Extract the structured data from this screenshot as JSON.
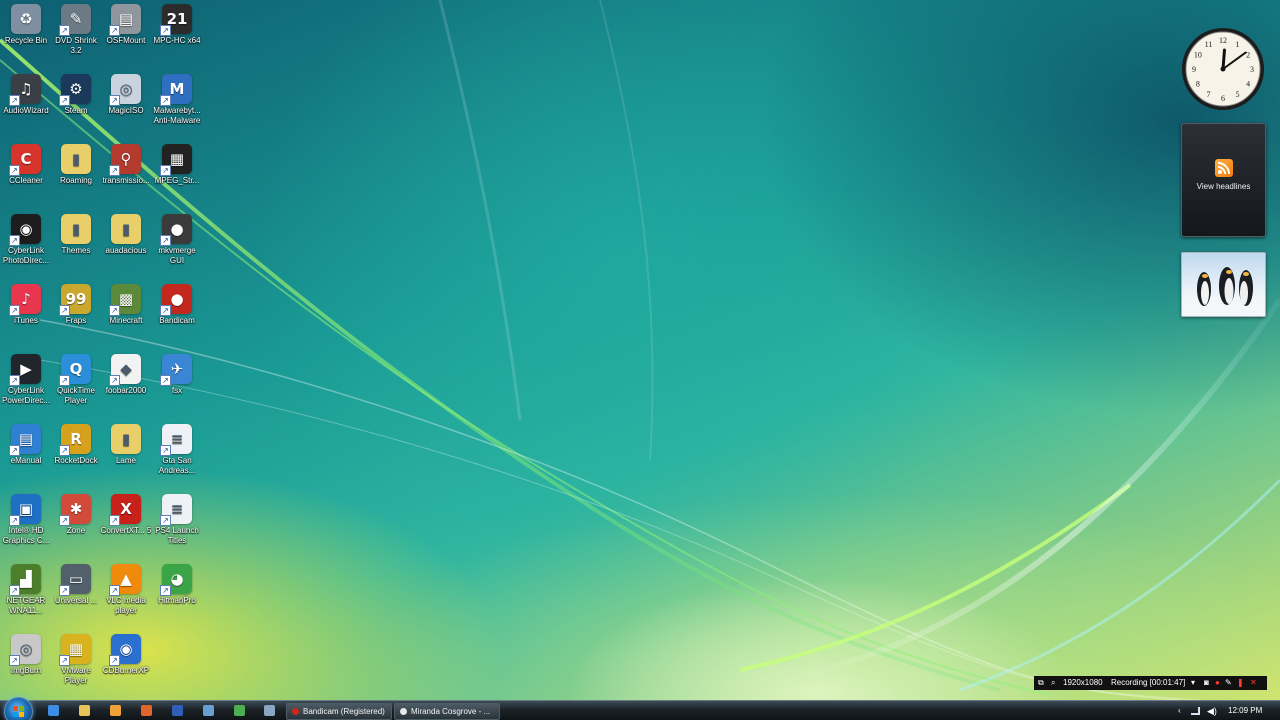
{
  "desktop_icons": [
    {
      "label": "Recycle Bin",
      "icon": "recycle-bin-icon",
      "color": "#7d8fa0",
      "glyph": "♻",
      "shortcut": false
    },
    {
      "label": "DVD Shrink 3.2",
      "icon": "dvd-shrink-icon",
      "color": "#6c7a86",
      "glyph": "✎",
      "shortcut": true
    },
    {
      "label": "OSFMount",
      "icon": "osfmount-icon",
      "color": "#8f969d",
      "glyph": "▤",
      "shortcut": true
    },
    {
      "label": "MPC-HC x64",
      "icon": "mpc-hc-icon",
      "color": "#2c2c2c",
      "glyph": "21",
      "shortcut": true
    },
    {
      "label": "AudioWizard",
      "icon": "audiowizard-icon",
      "color": "#3a3f46",
      "glyph": "♫",
      "shortcut": true
    },
    {
      "label": "Steam",
      "icon": "steam-icon",
      "color": "#1b3a5b",
      "glyph": "⚙",
      "shortcut": true
    },
    {
      "label": "MagicISO",
      "icon": "magiciso-icon",
      "color": "#c9d3df",
      "glyph": "◎",
      "shortcut": true
    },
    {
      "label": "Malwarebyt... Anti-Malware",
      "icon": "malwarebytes-icon",
      "color": "#2f6fc1",
      "glyph": "M",
      "shortcut": true
    },
    {
      "label": "CCleaner",
      "icon": "ccleaner-icon",
      "color": "#d8342c",
      "glyph": "C",
      "shortcut": true
    },
    {
      "label": "Roaming",
      "icon": "folder-icon",
      "color": "#e8cf6a",
      "glyph": "▮",
      "shortcut": false
    },
    {
      "label": "transmissio...",
      "icon": "transmission-icon",
      "color": "#b23b2e",
      "glyph": "⚲",
      "shortcut": true
    },
    {
      "label": "MPEG_Str...",
      "icon": "clapper-icon",
      "color": "#222222",
      "glyph": "▦",
      "shortcut": true
    },
    {
      "label": "CyberLink PhotoDirec...",
      "icon": "photodirector-icon",
      "color": "#1d1d1d",
      "glyph": "◉",
      "shortcut": true
    },
    {
      "label": "Themes",
      "icon": "folder-icon",
      "color": "#e8cf6a",
      "glyph": "▮",
      "shortcut": false
    },
    {
      "label": "auadacious",
      "icon": "folder-icon",
      "color": "#e8cf6a",
      "glyph": "▮",
      "shortcut": false
    },
    {
      "label": "mkvmerge GUI",
      "icon": "mkvmerge-icon",
      "color": "#3b3b3b",
      "glyph": "●",
      "shortcut": true
    },
    {
      "label": "iTunes",
      "icon": "itunes-icon",
      "color": "#e8364f",
      "glyph": "♪",
      "shortcut": true
    },
    {
      "label": "Fraps",
      "icon": "fraps-icon",
      "color": "#caa82e",
      "glyph": "99",
      "shortcut": true
    },
    {
      "label": "Minecraft",
      "icon": "minecraft-icon",
      "color": "#5b8a3a",
      "glyph": "▩",
      "shortcut": true
    },
    {
      "label": "Bandicam",
      "icon": "bandicam-icon",
      "color": "#c2281d",
      "glyph": "●",
      "shortcut": true
    },
    {
      "label": "CyberLink PowerDirec...",
      "icon": "powerdirector-icon",
      "color": "#20262b",
      "glyph": "▶",
      "shortcut": true
    },
    {
      "label": "QuickTime Player",
      "icon": "quicktime-icon",
      "color": "#2a8fd8",
      "glyph": "Q",
      "shortcut": true
    },
    {
      "label": "foobar2000",
      "icon": "foobar-icon",
      "color": "#f2f2f2",
      "glyph": "◆",
      "shortcut": true
    },
    {
      "label": "fsx",
      "icon": "flight-sim-icon",
      "color": "#3a86d4",
      "glyph": "✈",
      "shortcut": true
    },
    {
      "label": "eManual",
      "icon": "emanual-icon",
      "color": "#2f7fd2",
      "glyph": "▤",
      "shortcut": true
    },
    {
      "label": "RocketDock",
      "icon": "rocketdock-icon",
      "color": "#d6a11d",
      "glyph": "R",
      "shortcut": true
    },
    {
      "label": "Lame",
      "icon": "folder-icon",
      "color": "#e8cf6a",
      "glyph": "▮",
      "shortcut": false
    },
    {
      "label": "Gta San Andreas...",
      "icon": "document-icon",
      "color": "#eef2f6",
      "glyph": "≡",
      "shortcut": true
    },
    {
      "label": "Intel® HD Graphics C...",
      "icon": "intel-graphics-icon",
      "color": "#1f6fc4",
      "glyph": "▣",
      "shortcut": true
    },
    {
      "label": "Zone",
      "icon": "zone-icon",
      "color": "#d24b3a",
      "glyph": "✱",
      "shortcut": true
    },
    {
      "label": "ConvertXT... 5",
      "icon": "convertx-icon",
      "color": "#c8201a",
      "glyph": "X",
      "shortcut": true
    },
    {
      "label": "PS4 Launch Titles",
      "icon": "document-icon",
      "color": "#eef2f6",
      "glyph": "≡",
      "shortcut": true
    },
    {
      "label": "NETGEAR WNA11...",
      "icon": "netgear-icon",
      "color": "#4d7f2b",
      "glyph": "▟",
      "shortcut": true
    },
    {
      "label": "Universal ...",
      "icon": "universal-icon",
      "color": "#51606b",
      "glyph": "▭",
      "shortcut": true
    },
    {
      "label": "VLC media player",
      "icon": "vlc-icon",
      "color": "#f08a0c",
      "glyph": "▲",
      "shortcut": true
    },
    {
      "label": "HitmanPro",
      "icon": "hitmanpro-icon",
      "color": "#3aa447",
      "glyph": "◕",
      "shortcut": true
    },
    {
      "label": "ImgBurn",
      "icon": "imgburn-icon",
      "color": "#c8c8c8",
      "glyph": "◎",
      "shortcut": true
    },
    {
      "label": "VMware Player",
      "icon": "vmware-icon",
      "color": "#d8b21f",
      "glyph": "▦",
      "shortcut": true
    },
    {
      "label": "CDBurnerXP",
      "icon": "cdburnerxp-icon",
      "color": "#2b6fcf",
      "glyph": "◉",
      "shortcut": true
    }
  ],
  "gadgets": {
    "clock": {
      "numerals": [
        "12",
        "1",
        "2",
        "3",
        "4",
        "5",
        "6",
        "7",
        "8",
        "9",
        "10",
        "11"
      ],
      "hour": 12,
      "minute": 9
    },
    "feed": {
      "label": "View headlines"
    }
  },
  "bandicam": {
    "resolution": "1920x1080",
    "recording": "Recording [00:01:47]"
  },
  "taskbar": {
    "quick_launch": [
      {
        "name": "ie-icon",
        "color": "#3a8ee6"
      },
      {
        "name": "explorer-icon",
        "color": "#e6c45a"
      },
      {
        "name": "media-player-icon",
        "color": "#f0a23a"
      },
      {
        "name": "firefox-icon",
        "color": "#e0652a"
      },
      {
        "name": "thunderbird-icon",
        "color": "#2f5fb8"
      },
      {
        "name": "network-icon",
        "color": "#6a9fd4"
      },
      {
        "name": "chrome-icon",
        "color": "#4caf50"
      },
      {
        "name": "remote-icon",
        "color": "#8aa6c4"
      }
    ],
    "buttons": [
      {
        "label": "Bandicam (Registered)",
        "icon_color": "#d0271c"
      },
      {
        "label": "Miranda Cosgrove - ...",
        "icon_color": "#e8e8e8"
      }
    ],
    "time": "12:09 PM"
  }
}
